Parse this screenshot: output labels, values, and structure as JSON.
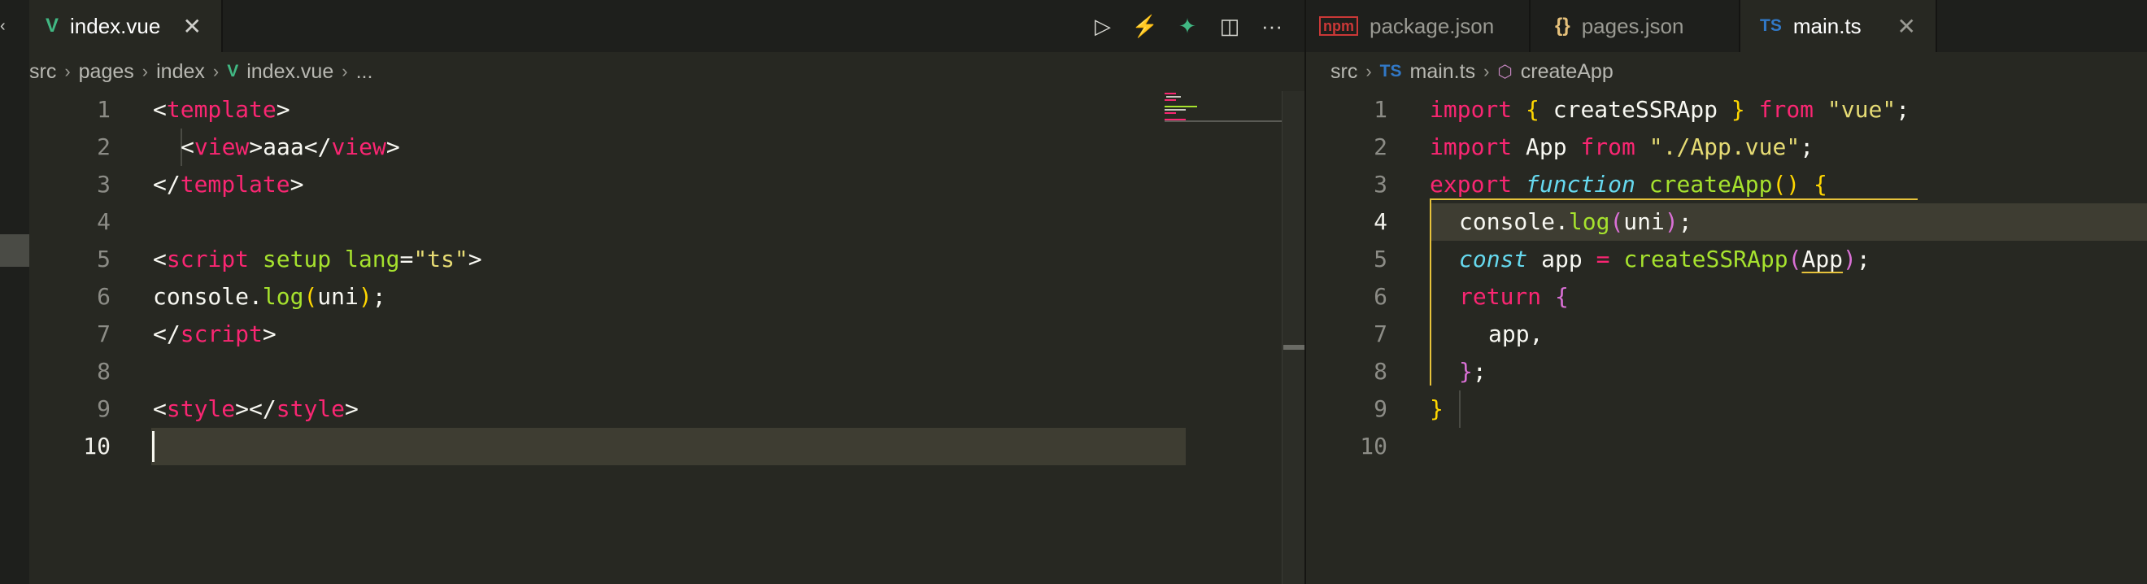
{
  "left_editor": {
    "tab": {
      "icon": "V",
      "label": "index.vue",
      "close": "✕"
    },
    "actions": [
      {
        "name": "run-icon",
        "glyph": "▷"
      },
      {
        "name": "vite-icon",
        "glyph": "⚡"
      },
      {
        "name": "vue-devtools-icon",
        "glyph": "✦"
      },
      {
        "name": "split-editor-icon",
        "glyph": "◫"
      },
      {
        "name": "more-actions-icon",
        "glyph": "···"
      }
    ],
    "breadcrumbs": [
      "src",
      "pages",
      "index",
      "index.vue",
      "..."
    ],
    "breadcrumb_sep": "›",
    "breadcrumb_file_icon": "V",
    "line_numbers": [
      "1",
      "2",
      "3",
      "4",
      "5",
      "6",
      "7",
      "8",
      "9",
      "10"
    ],
    "current_line": "10"
  },
  "right_editor": {
    "tabs": [
      {
        "icon": "npm",
        "label": "package.json"
      },
      {
        "icon": "{}",
        "label": "pages.json"
      },
      {
        "icon": "TS",
        "label": "main.ts",
        "close": "✕"
      }
    ],
    "breadcrumbs": [
      "src",
      "main.ts",
      "createApp"
    ],
    "breadcrumb_sep": "›",
    "breadcrumb_file_icon": "TS",
    "breadcrumb_symbol_icon": "⬡",
    "line_numbers": [
      "1",
      "2",
      "3",
      "4",
      "5",
      "6",
      "7",
      "8",
      "9",
      "10"
    ],
    "current_line": "4"
  },
  "colors": {
    "editor_bg": "#272822",
    "tag": "#f92672",
    "attribute": "#a6e22e",
    "string": "#e6db74",
    "keyword": "#f92672",
    "storage_type": "#66d9ef",
    "function": "#a6e22e",
    "bracket_gold": "#ffd700",
    "bracket_purple": "#da70d6",
    "vue_icon": "#41b883",
    "ts_icon": "#3178c6",
    "json_icon": "#e5c07b",
    "npm_icon": "#cb3837"
  }
}
